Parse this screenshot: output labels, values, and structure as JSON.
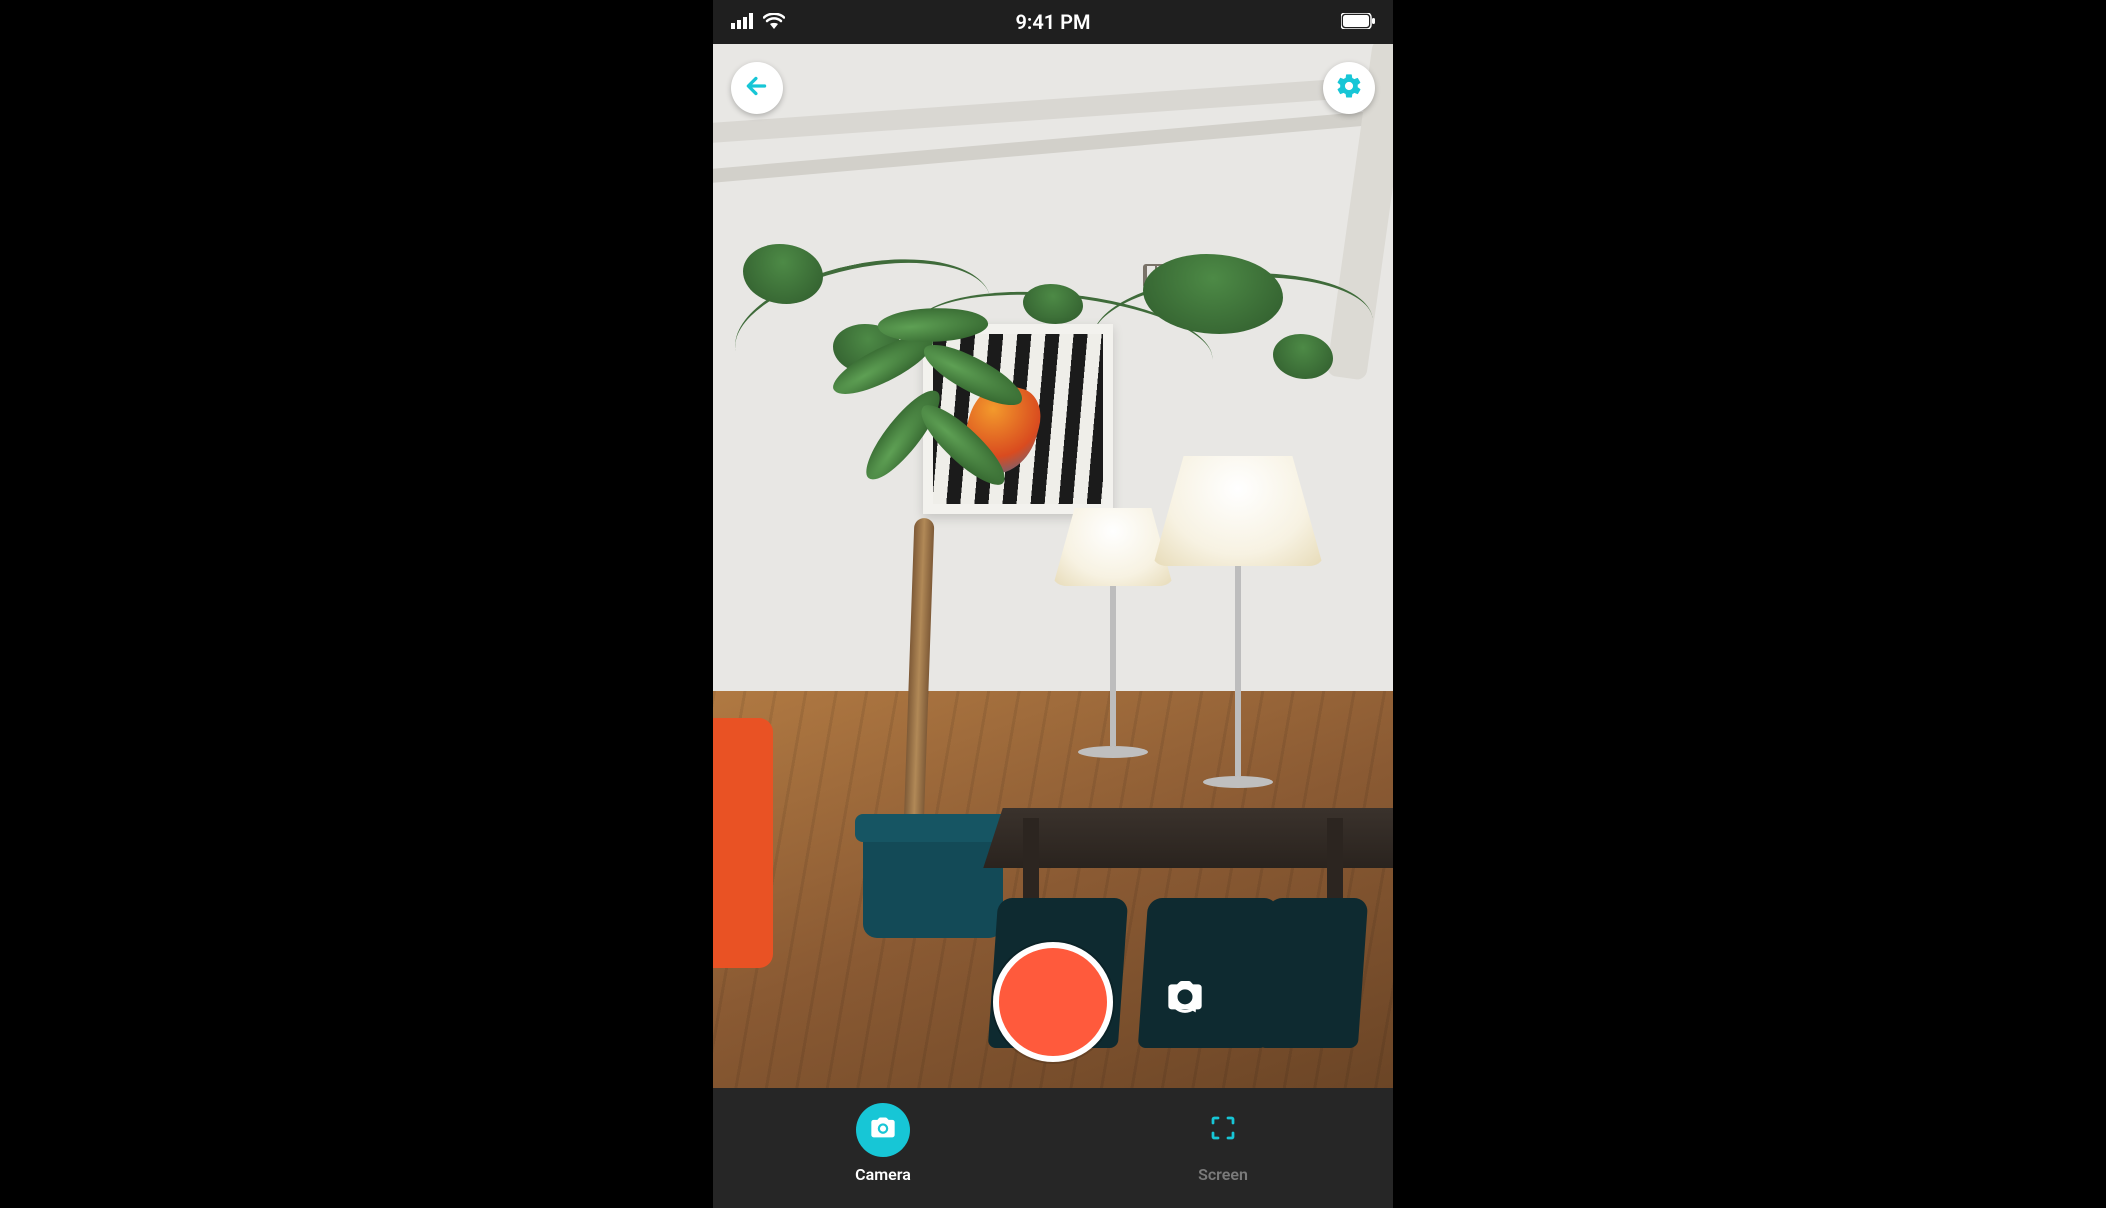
{
  "status": {
    "time": "9:41 PM"
  },
  "accent": "#17c6d6",
  "record_color": "#ff5a3c",
  "tabs": {
    "camera": {
      "label": "Camera"
    },
    "screen": {
      "label": "Screen"
    }
  }
}
